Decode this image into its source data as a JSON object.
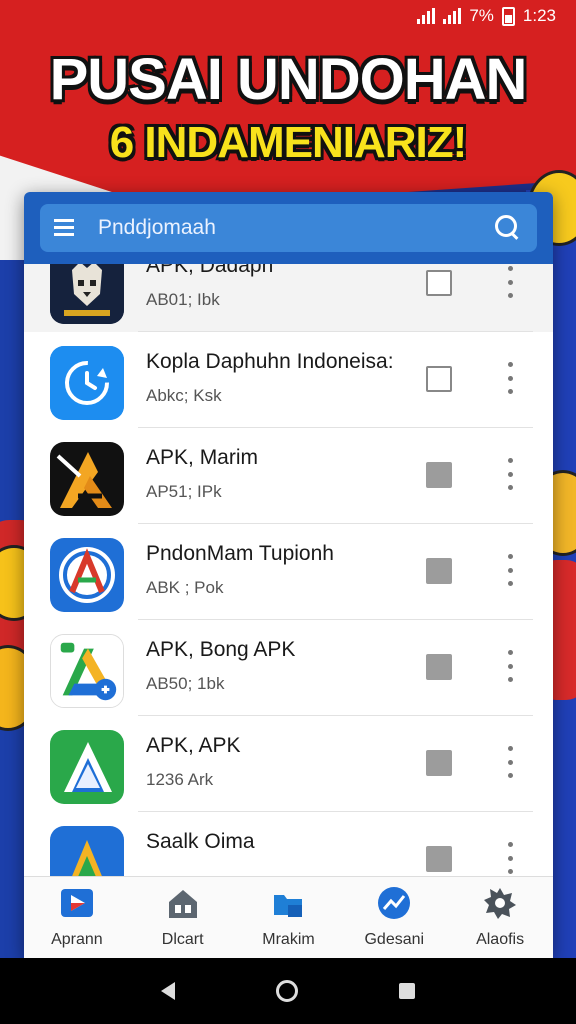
{
  "status_bar": {
    "battery": "7%",
    "time": "1:23"
  },
  "headline": {
    "line1": "PUSAI UNDOHAN",
    "line2": "6 INDAMENIARIZ!"
  },
  "search": {
    "placeholder": "Pnddjomaah"
  },
  "apps": [
    {
      "title": "APK, Dadaph",
      "subtitle": "AB01; Ibk",
      "checked": false
    },
    {
      "title": "Kopla Daphuhn Indoneisa:",
      "subtitle": "Abkc; Ksk",
      "checked": false
    },
    {
      "title": "APK, Marim",
      "subtitle": "AP51; IPk",
      "checked": true
    },
    {
      "title": "PndonMam Tupionh",
      "subtitle": "ABK ; Pok",
      "checked": true
    },
    {
      "title": "APK, Bong APK",
      "subtitle": "AB50; 1bk",
      "checked": true
    },
    {
      "title": "APK, APK",
      "subtitle": "1236 Ark",
      "checked": true
    },
    {
      "title": "Saalk Oima",
      "subtitle": "",
      "checked": true
    }
  ],
  "bottom_nav": [
    {
      "label": "Aprann",
      "icon": "play-store-icon"
    },
    {
      "label": "Dlcart",
      "icon": "home-icon"
    },
    {
      "label": "Mrakim",
      "icon": "folder-icon"
    },
    {
      "label": "Gdesani",
      "icon": "trending-icon"
    },
    {
      "label": "Alaofis",
      "icon": "gear-icon"
    }
  ],
  "colors": {
    "app_bar": "#1e5fbd",
    "search_bar": "#3b86d8",
    "headline_yellow": "#f8e21c",
    "flag_red": "#d62020"
  }
}
